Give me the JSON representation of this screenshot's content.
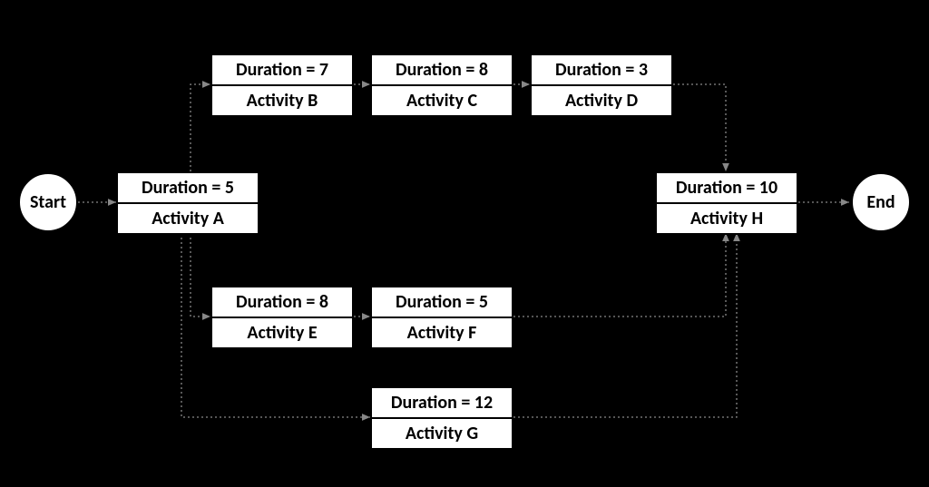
{
  "nodes": {
    "start": {
      "label": "Start"
    },
    "end": {
      "label": "End"
    },
    "A": {
      "duration": "Duration = 5",
      "activity": "Activity A"
    },
    "B": {
      "duration": "Duration = 7",
      "activity": "Activity B"
    },
    "C": {
      "duration": "Duration = 8",
      "activity": "Activity C"
    },
    "D": {
      "duration": "Duration = 3",
      "activity": "Activity D"
    },
    "E": {
      "duration": "Duration = 8",
      "activity": "Activity E"
    },
    "F": {
      "duration": "Duration = 5",
      "activity": "Activity F"
    },
    "G": {
      "duration": "Duration = 12",
      "activity": "Activity G"
    },
    "H": {
      "duration": "Duration = 10",
      "activity": "Activity H"
    }
  },
  "edges": [
    [
      "start",
      "A"
    ],
    [
      "A",
      "B"
    ],
    [
      "B",
      "C"
    ],
    [
      "C",
      "D"
    ],
    [
      "D",
      "H"
    ],
    [
      "A",
      "E"
    ],
    [
      "E",
      "F"
    ],
    [
      "F",
      "H"
    ],
    [
      "A",
      "G"
    ],
    [
      "G",
      "H"
    ],
    [
      "H",
      "end"
    ]
  ]
}
